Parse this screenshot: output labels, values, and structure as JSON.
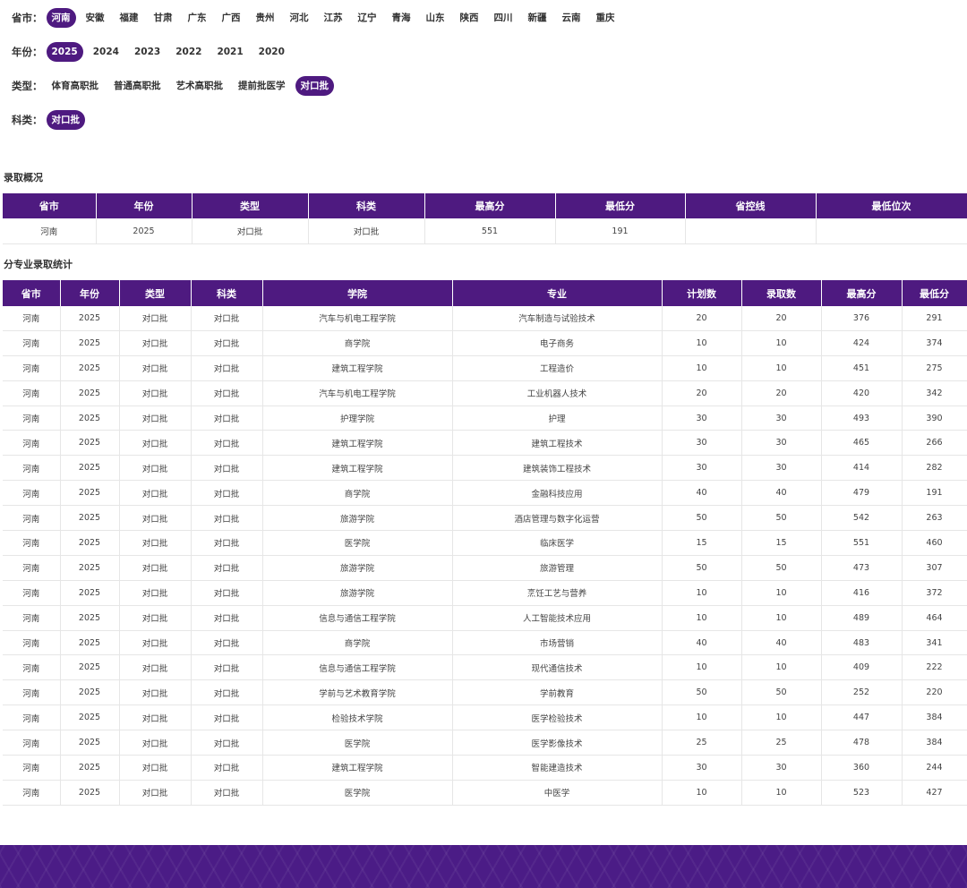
{
  "filters": {
    "province": {
      "label": "省市：",
      "selected": "河南",
      "options": [
        "河南",
        "安徽",
        "福建",
        "甘肃",
        "广东",
        "广西",
        "贵州",
        "河北",
        "江苏",
        "辽宁",
        "青海",
        "山东",
        "陕西",
        "四川",
        "新疆",
        "云南",
        "重庆"
      ]
    },
    "year": {
      "label": "年份：",
      "selected": "2025",
      "options": [
        "2025",
        "2024",
        "2023",
        "2022",
        "2021",
        "2020"
      ]
    },
    "type": {
      "label": "类型：",
      "selected": "对口批",
      "options": [
        "体育高职批",
        "普通高职批",
        "艺术高职批",
        "提前批医学",
        "对口批"
      ]
    },
    "subject": {
      "label": "科类：",
      "selected": "对口批",
      "options": [
        "对口批"
      ]
    }
  },
  "overview": {
    "title": "录取概况",
    "headers": [
      "省市",
      "年份",
      "类型",
      "科类",
      "最高分",
      "最低分",
      "省控线",
      "最低位次"
    ],
    "row": [
      "河南",
      "2025",
      "对口批",
      "对口批",
      "551",
      "191",
      "",
      ""
    ]
  },
  "majors": {
    "title": "分专业录取统计",
    "headers": [
      "省市",
      "年份",
      "类型",
      "科类",
      "学院",
      "专业",
      "计划数",
      "录取数",
      "最高分",
      "最低分"
    ],
    "rows": [
      [
        "河南",
        "2025",
        "对口批",
        "对口批",
        "汽车与机电工程学院",
        "汽车制造与试验技术",
        "20",
        "20",
        "376",
        "291"
      ],
      [
        "河南",
        "2025",
        "对口批",
        "对口批",
        "商学院",
        "电子商务",
        "10",
        "10",
        "424",
        "374"
      ],
      [
        "河南",
        "2025",
        "对口批",
        "对口批",
        "建筑工程学院",
        "工程造价",
        "10",
        "10",
        "451",
        "275"
      ],
      [
        "河南",
        "2025",
        "对口批",
        "对口批",
        "汽车与机电工程学院",
        "工业机器人技术",
        "20",
        "20",
        "420",
        "342"
      ],
      [
        "河南",
        "2025",
        "对口批",
        "对口批",
        "护理学院",
        "护理",
        "30",
        "30",
        "493",
        "390"
      ],
      [
        "河南",
        "2025",
        "对口批",
        "对口批",
        "建筑工程学院",
        "建筑工程技术",
        "30",
        "30",
        "465",
        "266"
      ],
      [
        "河南",
        "2025",
        "对口批",
        "对口批",
        "建筑工程学院",
        "建筑装饰工程技术",
        "30",
        "30",
        "414",
        "282"
      ],
      [
        "河南",
        "2025",
        "对口批",
        "对口批",
        "商学院",
        "金融科技应用",
        "40",
        "40",
        "479",
        "191"
      ],
      [
        "河南",
        "2025",
        "对口批",
        "对口批",
        "旅游学院",
        "酒店管理与数字化运营",
        "50",
        "50",
        "542",
        "263"
      ],
      [
        "河南",
        "2025",
        "对口批",
        "对口批",
        "医学院",
        "临床医学",
        "15",
        "15",
        "551",
        "460"
      ],
      [
        "河南",
        "2025",
        "对口批",
        "对口批",
        "旅游学院",
        "旅游管理",
        "50",
        "50",
        "473",
        "307"
      ],
      [
        "河南",
        "2025",
        "对口批",
        "对口批",
        "旅游学院",
        "烹饪工艺与营养",
        "10",
        "10",
        "416",
        "372"
      ],
      [
        "河南",
        "2025",
        "对口批",
        "对口批",
        "信息与通信工程学院",
        "人工智能技术应用",
        "10",
        "10",
        "489",
        "464"
      ],
      [
        "河南",
        "2025",
        "对口批",
        "对口批",
        "商学院",
        "市场营销",
        "40",
        "40",
        "483",
        "341"
      ],
      [
        "河南",
        "2025",
        "对口批",
        "对口批",
        "信息与通信工程学院",
        "现代通信技术",
        "10",
        "10",
        "409",
        "222"
      ],
      [
        "河南",
        "2025",
        "对口批",
        "对口批",
        "学前与艺术教育学院",
        "学前教育",
        "50",
        "50",
        "252",
        "220"
      ],
      [
        "河南",
        "2025",
        "对口批",
        "对口批",
        "检验技术学院",
        "医学检验技术",
        "10",
        "10",
        "447",
        "384"
      ],
      [
        "河南",
        "2025",
        "对口批",
        "对口批",
        "医学院",
        "医学影像技术",
        "25",
        "25",
        "478",
        "384"
      ],
      [
        "河南",
        "2025",
        "对口批",
        "对口批",
        "建筑工程学院",
        "智能建造技术",
        "30",
        "30",
        "360",
        "244"
      ],
      [
        "河南",
        "2025",
        "对口批",
        "对口批",
        "医学院",
        "中医学",
        "10",
        "10",
        "523",
        "427"
      ]
    ]
  },
  "colors": {
    "accent": "#4e1a80",
    "footer": "#4b1c86"
  }
}
